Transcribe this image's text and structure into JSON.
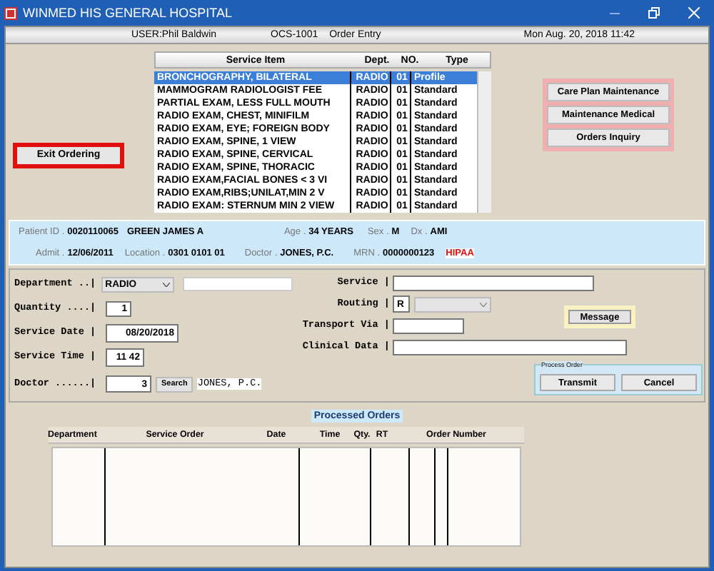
{
  "window": {
    "title": "WINMED HIS GENERAL HOSPITAL"
  },
  "header": {
    "user": "USER:Phil Baldwin",
    "module_code": "OCS-1001",
    "module": "Order Entry",
    "datetime": "Mon Aug. 20, 2018 11:42"
  },
  "exit_button": "Exit Ordering",
  "service_list": {
    "columns": [
      "Service Item",
      "Dept.",
      "NO.",
      "Type"
    ],
    "rows": [
      {
        "item": "BRONCHOGRAPHY, BILATERAL",
        "dept": "RADIO",
        "no": "01",
        "type": "Profile",
        "selected": true
      },
      {
        "item": "MAMMOGRAM RADIOLOGIST FEE",
        "dept": "RADIO",
        "no": "01",
        "type": "Standard",
        "selected": false
      },
      {
        "item": "PARTIAL EXAM, LESS FULL MOUTH",
        "dept": "RADIO",
        "no": "01",
        "type": "Standard",
        "selected": false
      },
      {
        "item": "RADIO EXAM, CHEST, MINIFILM",
        "dept": "RADIO",
        "no": "01",
        "type": "Standard",
        "selected": false
      },
      {
        "item": "RADIO EXAM, EYE; FOREIGN BODY",
        "dept": "RADIO",
        "no": "01",
        "type": "Standard",
        "selected": false
      },
      {
        "item": "RADIO EXAM, SPINE, 1 VIEW",
        "dept": "RADIO",
        "no": "01",
        "type": "Standard",
        "selected": false
      },
      {
        "item": "RADIO EXAM, SPINE, CERVICAL",
        "dept": "RADIO",
        "no": "01",
        "type": "Standard",
        "selected": false
      },
      {
        "item": "RADIO EXAM, SPINE, THORACIC",
        "dept": "RADIO",
        "no": "01",
        "type": "Standard",
        "selected": false
      },
      {
        "item": "RADIO EXAM,FACIAL BONES < 3 VI",
        "dept": "RADIO",
        "no": "01",
        "type": "Standard",
        "selected": false
      },
      {
        "item": "RADIO EXAM,RIBS;UNILAT,MIN 2 V",
        "dept": "RADIO",
        "no": "01",
        "type": "Standard",
        "selected": false
      },
      {
        "item": "RADIO EXAM: STERNUM MIN 2 VIEW",
        "dept": "RADIO",
        "no": "01",
        "type": "Standard",
        "selected": false
      }
    ]
  },
  "side_buttons": [
    "Care Plan Maintenance",
    "Maintenance Medical",
    "Orders Inquiry"
  ],
  "patient": {
    "patient_id": {
      "label": "Patient ID .",
      "value": "0020110065"
    },
    "name": "GREEN JAMES A",
    "age": {
      "label": "Age .",
      "value": "34 YEARS"
    },
    "sex": {
      "label": "Sex .",
      "value": "M"
    },
    "dx": {
      "label": "Dx .",
      "value": "AMI"
    },
    "admit": {
      "label": "Admit .",
      "value": "12/06/2011"
    },
    "location": {
      "label": "Location .",
      "value": "0301 0101 01"
    },
    "doctor": {
      "label": "Doctor .",
      "value": "JONES, P.C."
    },
    "mrn": {
      "label": "MRN .",
      "value": "0000000123"
    },
    "hipaa": "HIPAA"
  },
  "form": {
    "left": [
      {
        "kind": "dropdown",
        "label": "Department ..|",
        "value": "RADIO"
      },
      {
        "kind": "number",
        "label": "Quantity ....|",
        "value": "1"
      },
      {
        "kind": "date",
        "label": "Service Date |",
        "value": "08/20/2018"
      },
      {
        "kind": "time",
        "label": "Service Time |",
        "value": "11 42"
      },
      {
        "kind": "lookup",
        "label": "Doctor ......|",
        "value": "3",
        "button": "Search",
        "result": "JONES, P.C."
      }
    ],
    "middle": [
      {
        "kind": "text",
        "label": "Service |"
      },
      {
        "kind": "routing",
        "label": "Routing |",
        "value": "R"
      },
      {
        "kind": "short",
        "label": "Transport Via |"
      },
      {
        "kind": "wide",
        "label": "Clinical Data |"
      }
    ],
    "message_button": "Message",
    "process_order": {
      "title": "Process Order",
      "buttons": [
        "Transmit",
        "Cancel"
      ]
    }
  },
  "processed_orders": {
    "title": "Processed Orders",
    "columns": [
      "Department",
      "Service Order",
      "Date",
      "Time",
      "Qty.",
      "RT",
      "Order Number"
    ]
  }
}
